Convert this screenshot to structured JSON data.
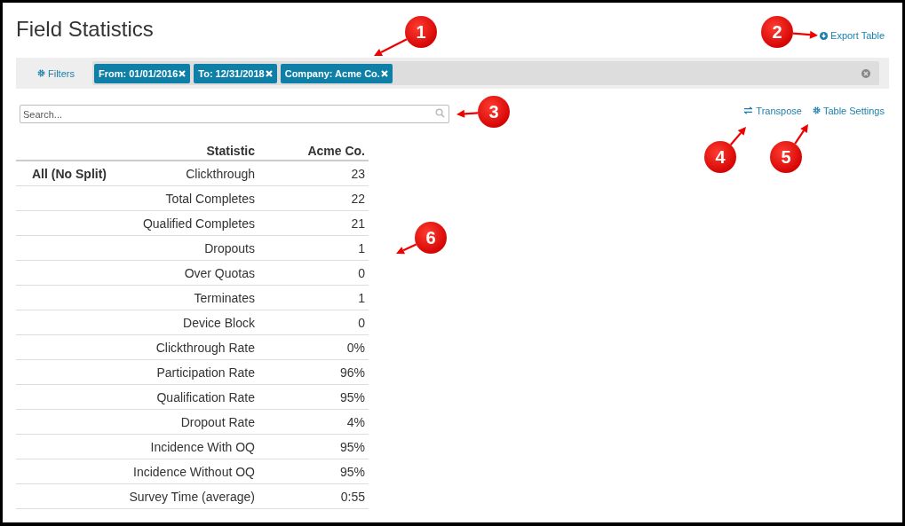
{
  "page": {
    "title": "Field Statistics",
    "export_link": "Export Table"
  },
  "filters": {
    "label": "Filters",
    "chips": [
      {
        "label": "From: 01/01/2016"
      },
      {
        "label": "To: 12/31/2018"
      },
      {
        "label": "Company: Acme Co."
      }
    ]
  },
  "search": {
    "placeholder": "Search..."
  },
  "toolbar": [
    {
      "kind": "transpose",
      "label": "Transpose"
    },
    {
      "kind": "settings",
      "label": "Table Settings"
    }
  ],
  "table": {
    "columns": [
      "Statistic",
      "Acme Co."
    ],
    "group": "All (No Split)",
    "rows": [
      [
        "Clickthrough",
        "23"
      ],
      [
        "Total Completes",
        "22"
      ],
      [
        "Qualified Completes",
        "21"
      ],
      [
        "Dropouts",
        "1"
      ],
      [
        "Over Quotas",
        "0"
      ],
      [
        "Terminates",
        "1"
      ],
      [
        "Device Block",
        "0"
      ],
      [
        "Clickthrough Rate",
        "0%"
      ],
      [
        "Participation Rate",
        "96%"
      ],
      [
        "Qualification Rate",
        "95%"
      ],
      [
        "Dropout Rate",
        "4%"
      ],
      [
        "Incidence With OQ",
        "95%"
      ],
      [
        "Incidence Without OQ",
        "95%"
      ],
      [
        "Survey Time (average)",
        "0:55"
      ]
    ]
  },
  "callouts": [
    {
      "number": "1"
    },
    {
      "number": "2"
    },
    {
      "number": "3"
    },
    {
      "number": "4"
    },
    {
      "number": "5"
    },
    {
      "number": "6"
    }
  ]
}
